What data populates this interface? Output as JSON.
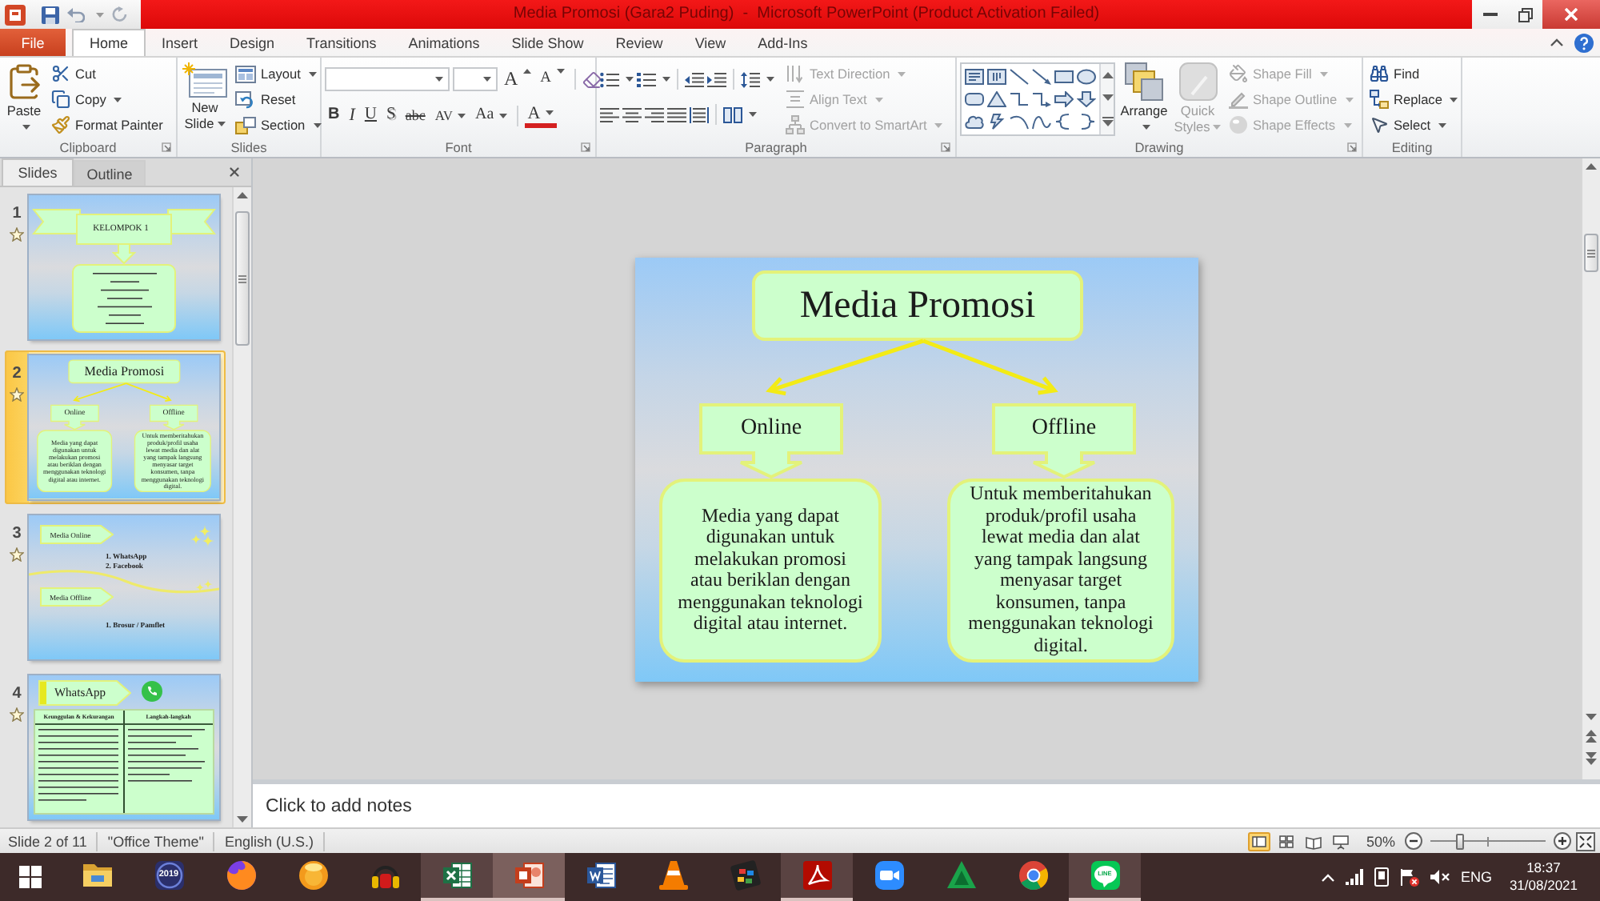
{
  "window": {
    "title": "Media Promosi (Gara2 Puding)  -  Microsoft PowerPoint (Product Activation Failed)"
  },
  "tabs": [
    {
      "label": "File",
      "kind": "file",
      "selected": false
    },
    {
      "label": "Home",
      "kind": "tab",
      "selected": true
    },
    {
      "label": "Insert",
      "kind": "tab",
      "selected": false
    },
    {
      "label": "Design",
      "kind": "tab",
      "selected": false
    },
    {
      "label": "Transitions",
      "kind": "tab",
      "selected": false
    },
    {
      "label": "Animations",
      "kind": "tab",
      "selected": false
    },
    {
      "label": "Slide Show",
      "kind": "tab",
      "selected": false
    },
    {
      "label": "Review",
      "kind": "tab",
      "selected": false
    },
    {
      "label": "View",
      "kind": "tab",
      "selected": false
    },
    {
      "label": "Add-Ins",
      "kind": "tab",
      "selected": false
    }
  ],
  "ribbon": {
    "clipboard": {
      "label": "Clipboard",
      "paste": "Paste",
      "items": [
        {
          "label": "Cut",
          "kind": "cut",
          "dropdown": false
        },
        {
          "label": "Copy",
          "kind": "copy",
          "dropdown": true
        },
        {
          "label": "Format Painter",
          "kind": "painter",
          "dropdown": false
        }
      ]
    },
    "slides": {
      "label": "Slides",
      "new_slide": "New Slide",
      "items": [
        {
          "label": "Layout",
          "kind": "layout",
          "dropdown": true
        },
        {
          "label": "Reset",
          "kind": "reset",
          "dropdown": false
        },
        {
          "label": "Section",
          "kind": "section",
          "dropdown": true
        }
      ]
    },
    "font": {
      "label": "Font",
      "size_buttons": [
        {
          "label": "A",
          "kind": "grow"
        },
        {
          "label": "A",
          "kind": "shrink"
        }
      ],
      "format_buttons": [
        {
          "label": "B",
          "kind": "bold"
        },
        {
          "label": "I",
          "kind": "italic"
        },
        {
          "label": "U",
          "kind": "underline"
        },
        {
          "label": "S",
          "kind": "shadow"
        },
        {
          "label": "abc",
          "kind": "strike"
        },
        {
          "label": "AV",
          "kind": "spacing"
        },
        {
          "label": "Aa",
          "kind": "case"
        },
        {
          "label": "A",
          "kind": "color"
        }
      ]
    },
    "paragraph": {
      "label": "Paragraph",
      "items": [
        {
          "label": "Text Direction",
          "kind": "direction",
          "disabled": true
        },
        {
          "label": "Align Text",
          "kind": "align",
          "disabled": true
        },
        {
          "label": "Convert to SmartArt",
          "kind": "smartart",
          "disabled": true
        }
      ]
    },
    "drawing": {
      "label": "Drawing",
      "large_buttons": [
        {
          "label": "Arrange",
          "kind": "arrange",
          "disabled": false
        },
        {
          "label": "Quick Styles",
          "kind": "styles",
          "disabled": true
        }
      ],
      "items": [
        {
          "label": "Shape Fill",
          "kind": "fill",
          "disabled": true
        },
        {
          "label": "Shape Outline",
          "kind": "outline",
          "disabled": true
        },
        {
          "label": "Shape Effects",
          "kind": "effects",
          "disabled": true
        }
      ]
    },
    "editing": {
      "label": "Editing",
      "items": [
        {
          "label": "Find",
          "kind": "find",
          "dropdown": false
        },
        {
          "label": "Replace",
          "kind": "replace",
          "dropdown": true
        },
        {
          "label": "Select",
          "kind": "select",
          "dropdown": true
        }
      ]
    }
  },
  "side_panel": {
    "tabs": [
      {
        "label": "Slides",
        "selected": true
      },
      {
        "label": "Outline",
        "selected": false
      }
    ]
  },
  "slides": [
    {
      "number": "1",
      "selected": false,
      "kind": "title",
      "title": "KELOMPOK 1"
    },
    {
      "number": "2",
      "selected": true,
      "kind": "diagram",
      "title": "Media Promosi",
      "branches": [
        {
          "label": "Online",
          "text": "Media yang dapat\ndigunakan untuk\nmelakukan promosi\natau beriklan dengan\nmenggunakan teknologi\ndigital  atau internet."
        },
        {
          "label": "Offline",
          "text": "Untuk memberitahukan\nproduk/profil usaha\nlewat media dan alat\nyang tampak langsung\nmenyasar target\nkonsumen, tanpa\nmenggunakan teknologi\ndigital."
        }
      ]
    },
    {
      "number": "3",
      "selected": false,
      "kind": "lists",
      "sections": [
        {
          "label": "Media Online",
          "items": [
            "1. WhatsApp",
            "2. Facebook"
          ]
        },
        {
          "label": "Media Offline",
          "items": [
            "1. Brosur / Pamflet"
          ]
        }
      ]
    },
    {
      "number": "4",
      "selected": false,
      "kind": "table",
      "title": "WhatsApp",
      "columns": [
        "Keunggulan & Kekurangan",
        "Langkah-langkah"
      ]
    }
  ],
  "slide": {
    "title": "Media Promosi",
    "branches": [
      {
        "label": "Online",
        "text": "Media yang dapat\ndigunakan untuk\nmelakukan promosi\natau beriklan dengan\nmenggunakan teknologi\ndigital  atau internet."
      },
      {
        "label": "Offline",
        "text": "Untuk memberitahukan\nproduk/profil usaha\nlewat media dan alat\nyang tampak langsung\nmenyasar target\nkonsumen, tanpa\nmenggunakan teknologi\ndigital."
      }
    ]
  },
  "notes": {
    "placeholder": "Click to add notes"
  },
  "status_bar": {
    "slide": "Slide 2 of 11",
    "theme": "\"Office Theme\"",
    "language": "English (U.S.)",
    "views": [
      {
        "kind": "normal",
        "selected": true
      },
      {
        "kind": "sorter",
        "selected": false
      },
      {
        "kind": "reading",
        "selected": false
      },
      {
        "kind": "slideshow",
        "selected": false
      }
    ],
    "zoom": "50%",
    "zoom_slider": {
      "level": 0.25
    }
  },
  "taskbar": {
    "apps": [
      {
        "kind": "folder",
        "running": false,
        "selected": false
      },
      {
        "kind": "calendar",
        "label": "2019",
        "running": false,
        "selected": false
      },
      {
        "kind": "fox",
        "running": false,
        "selected": false
      },
      {
        "kind": "ball",
        "running": false,
        "selected": false
      },
      {
        "kind": "headphones",
        "running": false,
        "selected": false
      },
      {
        "kind": "spreadsheet",
        "running": true,
        "selected": false
      },
      {
        "kind": "presentation",
        "running": true,
        "selected": true
      },
      {
        "kind": "document",
        "running": false,
        "selected": false
      },
      {
        "kind": "cone",
        "running": false,
        "selected": false
      },
      {
        "kind": "film",
        "running": false,
        "selected": false
      },
      {
        "kind": "pdf",
        "running": true,
        "selected": false
      },
      {
        "kind": "camera",
        "running": false,
        "selected": false
      },
      {
        "kind": "triangle",
        "running": false,
        "selected": false
      },
      {
        "kind": "wheel",
        "running": false,
        "selected": false
      },
      {
        "kind": "chat",
        "label": "LINE",
        "running": true,
        "selected": false
      }
    ],
    "language": "ENG",
    "time": "18:37",
    "date": "31/08/2021"
  }
}
